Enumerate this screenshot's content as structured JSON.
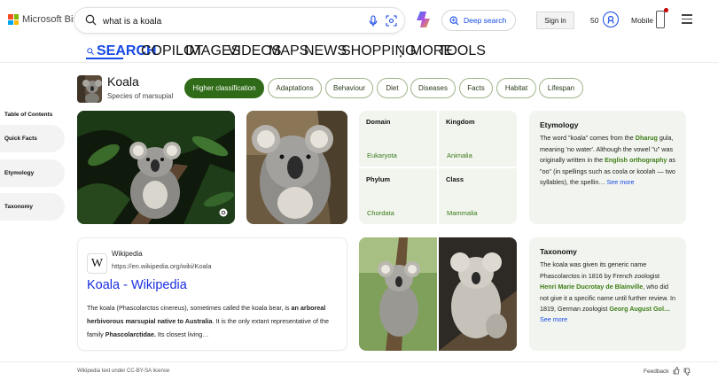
{
  "brand": {
    "name": "Microsoft Bing"
  },
  "search": {
    "query": "what is a koala"
  },
  "header": {
    "deep_search": "Deep search",
    "sign_in": "Sign in",
    "points": "50",
    "mobile": "Mobile"
  },
  "tabs": [
    {
      "label": "SEARCH",
      "active": true
    },
    {
      "label": "COPILOT"
    },
    {
      "label": "IMAGES"
    },
    {
      "label": "VIDEOS"
    },
    {
      "label": "MAPS"
    },
    {
      "label": "NEWS"
    },
    {
      "label": "SHOPPING"
    },
    {
      "label": "MORE"
    },
    {
      "label": "TOOLS"
    }
  ],
  "toc": {
    "title": "Table of Contents",
    "items": [
      "Quick Facts",
      "Etymology",
      "Taxonomy"
    ]
  },
  "entity": {
    "name": "Koala",
    "subtitle": "Species of marsupial"
  },
  "pills": [
    {
      "label": "Higher classification",
      "active": true
    },
    {
      "label": "Adaptations"
    },
    {
      "label": "Behaviour"
    },
    {
      "label": "Diet"
    },
    {
      "label": "Diseases"
    },
    {
      "label": "Facts"
    },
    {
      "label": "Habitat"
    },
    {
      "label": "Lifespan"
    }
  ],
  "taxonomy_grid": [
    {
      "key": "Domain",
      "value": "Eukaryota"
    },
    {
      "key": "Kingdom",
      "value": "Animalia"
    },
    {
      "key": "Phylum",
      "value": "Chordata"
    },
    {
      "key": "Class",
      "value": "Mammalia"
    }
  ],
  "etymology": {
    "title": "Etymology",
    "t1": "The word \"koala\" comes from the ",
    "l1": "Dharug",
    "t2": " gula, meaning 'no water'. Although the vowel \"u\" was originally written in the ",
    "l2": "English orthography",
    "t3": " as \"oo\" (in spellings such as coola or koolah — two syllables), the spellin…",
    "more": "See more"
  },
  "taxonomy": {
    "title": "Taxonomy",
    "t1": "The koala was given its generic name Phascolarctos in 1816 by French zoologist ",
    "l1": "Henri Marie Ducrotay de Blainville",
    "t2": ", who did not give it a specific name until further review. In 1819, German zoologist ",
    "l2": "Georg August Gol…",
    "more": "See more"
  },
  "wiki": {
    "source": "Wikipedia",
    "url": "https://en.wikipedia.org/wiki/Koala",
    "title": "Koala - Wikipedia",
    "d1": "The koala (Phascolarctos cinereus), sometimes called the koala bear, is ",
    "d2": "an arboreal herbivorous marsupial native to Australia",
    "d3": ". It is the only extant representative of the family ",
    "d4": "Phascolarctidae.",
    "d5": " Its closest living…"
  },
  "footer": {
    "license": "Wikipedia text under CC-BY-SA license",
    "feedback": "Feedback"
  },
  "colors": {
    "accent": "#174ae4",
    "pill_active": "#2f6b18",
    "link_green": "#3d7d16"
  }
}
